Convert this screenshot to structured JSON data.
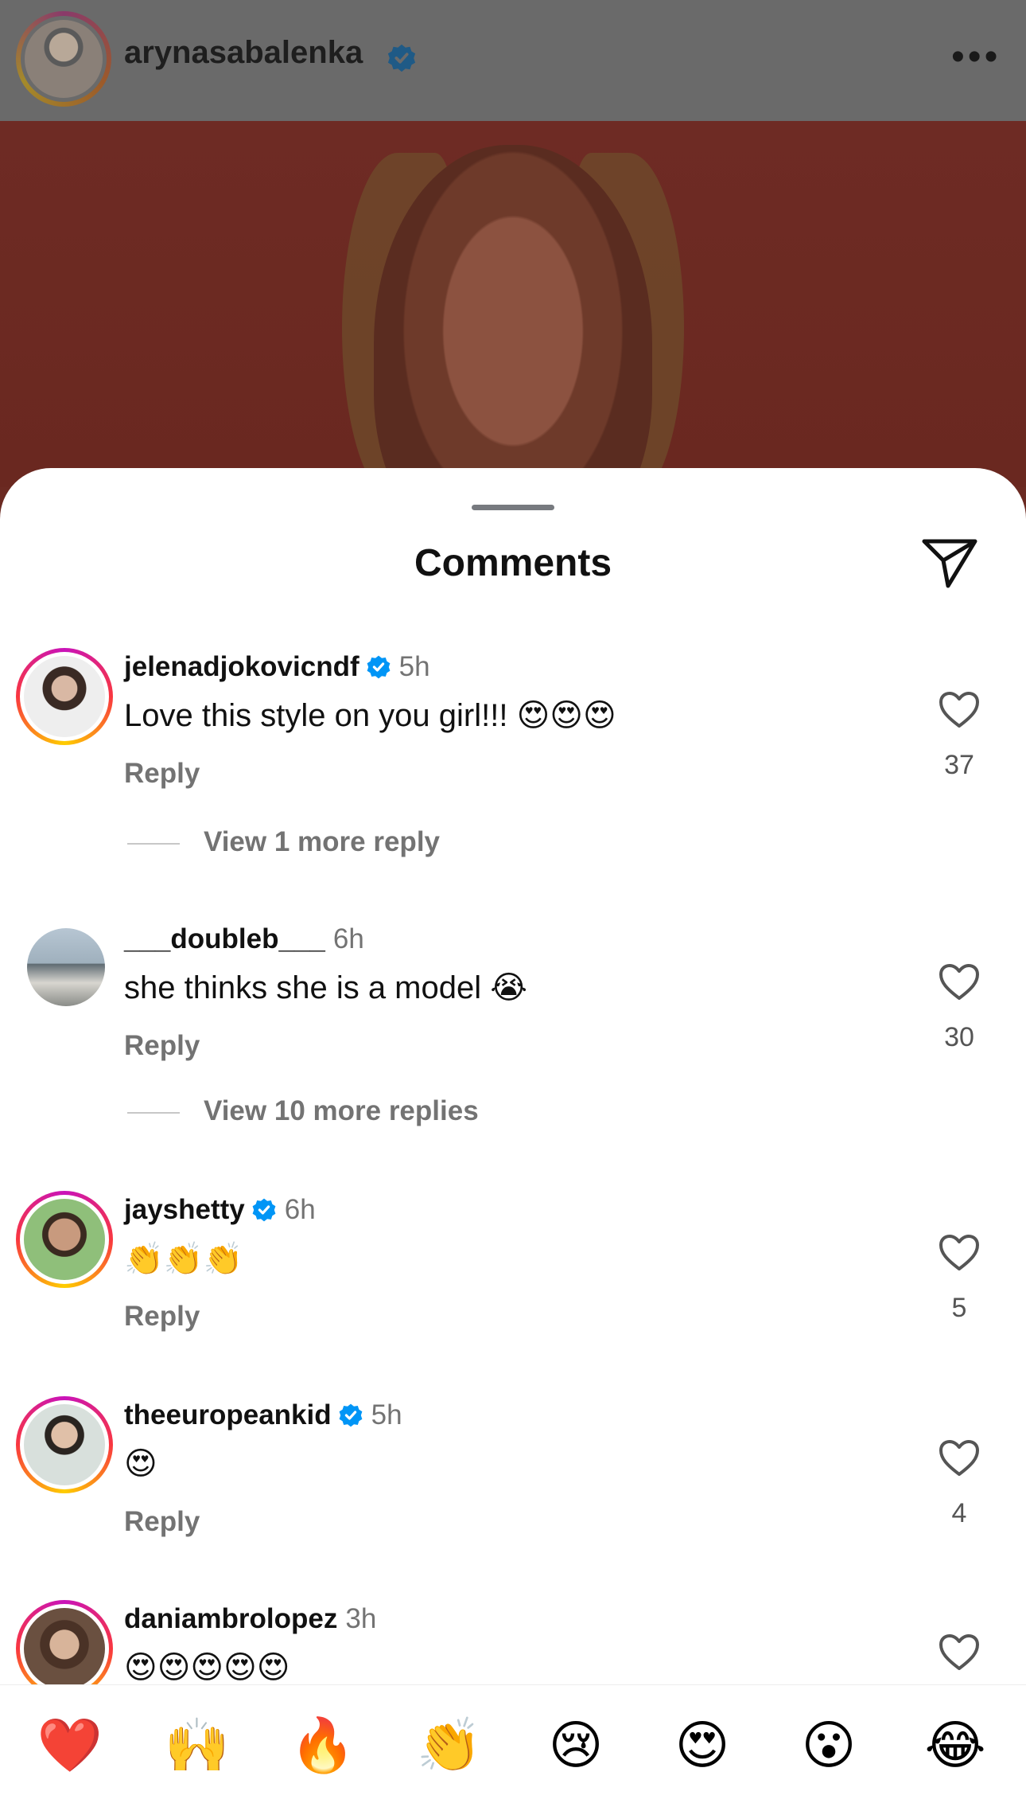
{
  "post": {
    "username": "arynasabalenka",
    "verified": true,
    "more_label": "•••"
  },
  "sheet": {
    "title": "Comments"
  },
  "comments": [
    {
      "username": "jelenadjokovicndf",
      "verified": true,
      "time": "5h",
      "text": "Love this style on you girl!!! 😍😍😍",
      "reply_label": "Reply",
      "likes": "37",
      "view_replies": "View 1 more reply",
      "story_ring": true
    },
    {
      "username": "___doubleb___",
      "verified": false,
      "time": "6h",
      "text": "she thinks she is a model 😭",
      "reply_label": "Reply",
      "likes": "30",
      "view_replies": "View 10 more replies",
      "story_ring": false
    },
    {
      "username": "jayshetty",
      "verified": true,
      "time": "6h",
      "text": "👏👏👏",
      "reply_label": "Reply",
      "likes": "5",
      "story_ring": true
    },
    {
      "username": "theeuropeankid",
      "verified": true,
      "time": "5h",
      "text": "😍",
      "reply_label": "Reply",
      "likes": "4",
      "story_ring": true
    },
    {
      "username": "daniambrolopez",
      "verified": false,
      "time": "3h",
      "text": "😍😍😍😍😍",
      "story_ring": true
    }
  ],
  "quick_reactions": [
    "❤️",
    "🙌",
    "🔥",
    "👏",
    "😢",
    "😍",
    "😮",
    "😂"
  ],
  "colors": {
    "verified": "#0095f6",
    "secondary_text": "#737373",
    "heart_outline": "#555555"
  },
  "icons": {
    "share": "paper-plane-icon",
    "like": "heart-outline-icon",
    "verified": "verified-badge-icon",
    "more": "more-horizontal-icon"
  }
}
